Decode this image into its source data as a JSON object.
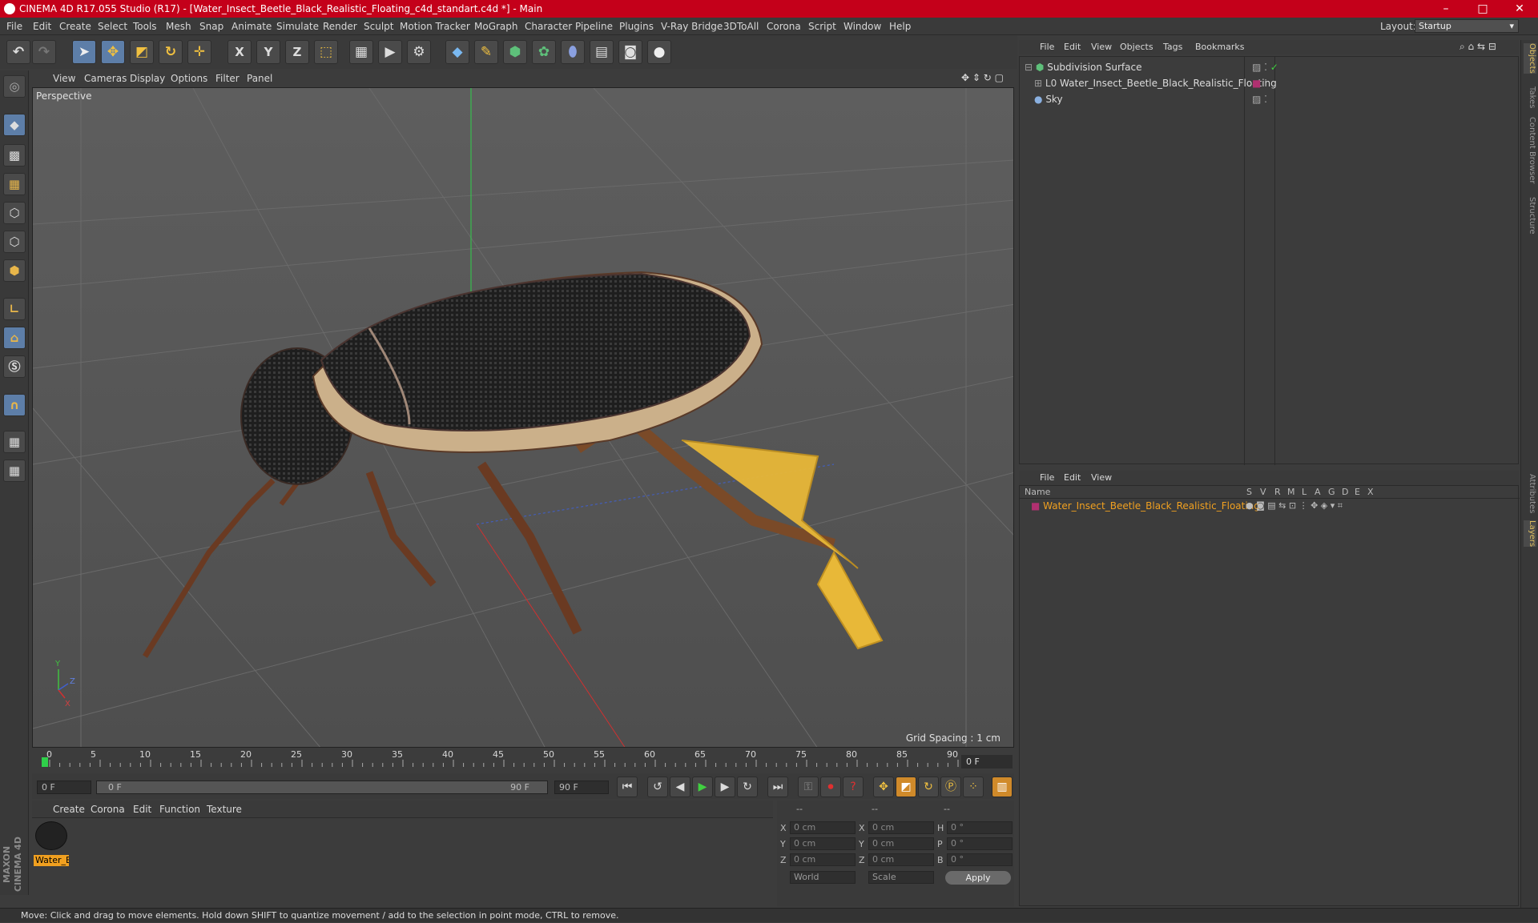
{
  "window": {
    "title": "CINEMA 4D R17.055 Studio (R17) - [Water_Insect_Beetle_Black_Realistic_Floating_c4d_standart.c4d *] - Main",
    "controls": [
      "–",
      "□",
      "✕"
    ]
  },
  "menu": [
    "File",
    "Edit",
    "Create",
    "Select",
    "Tools",
    "Mesh",
    "Snap",
    "Animate",
    "Simulate",
    "Render",
    "Sculpt",
    "Motion Tracker",
    "MoGraph",
    "Character",
    "Pipeline",
    "Plugins",
    "V-Ray Bridge",
    "3DToAll",
    "Corona",
    "Script",
    "Window",
    "Help"
  ],
  "layout": {
    "label": "Layout:",
    "value": "Startup"
  },
  "toolbar_xyz": [
    "X",
    "Y",
    "Z"
  ],
  "viewport": {
    "menu": [
      "View",
      "Cameras",
      "Display",
      "Options",
      "Filter",
      "Panel"
    ],
    "label": "Perspective",
    "grid_spacing": "Grid Spacing : 1 cm",
    "axis_labels": [
      "Y",
      "Z",
      "X"
    ]
  },
  "timeline": {
    "ticks": [
      "0",
      "5",
      "10",
      "15",
      "20",
      "25",
      "30",
      "35",
      "40",
      "45",
      "50",
      "55",
      "60",
      "65",
      "70",
      "75",
      "80",
      "85",
      "90"
    ],
    "current_frame": "0 F",
    "start_field": "0 F",
    "range_start": "0 F",
    "range_end": "90 F",
    "end_field": "90 F"
  },
  "material_manager": {
    "menu": [
      "Create",
      "Corona",
      "Edit",
      "Function",
      "Texture"
    ],
    "materials": [
      {
        "label": "Water_E"
      }
    ]
  },
  "coordinates": {
    "headers": [
      "--",
      "--",
      "--"
    ],
    "rows": [
      {
        "a": "X",
        "av": "0 cm",
        "b": "X",
        "bv": "0 cm",
        "c": "H",
        "cv": "0 °"
      },
      {
        "a": "Y",
        "av": "0 cm",
        "b": "Y",
        "bv": "0 cm",
        "c": "P",
        "cv": "0 °"
      },
      {
        "a": "Z",
        "av": "0 cm",
        "b": "Z",
        "bv": "0 cm",
        "c": "B",
        "cv": "0 °"
      }
    ],
    "mode1": "World",
    "mode2": "Scale",
    "apply": "Apply"
  },
  "object_manager": {
    "menu": [
      "File",
      "Edit",
      "View",
      "Objects",
      "Tags",
      "Bookmarks"
    ],
    "objects": [
      {
        "name": "Subdivision Surface"
      },
      {
        "name": "Water_Insect_Beetle_Black_Realistic_Floating"
      },
      {
        "name": "Sky"
      }
    ]
  },
  "layer_manager": {
    "menu": [
      "File",
      "Edit",
      "View"
    ],
    "columns": [
      "Name",
      "S",
      "V",
      "R",
      "M",
      "L",
      "A",
      "G",
      "D",
      "E",
      "X"
    ],
    "layers": [
      {
        "name": "Water_Insect_Beetle_Black_Realistic_Floating",
        "color": "#b03070"
      }
    ]
  },
  "right_tabs": [
    "Objects",
    "Takes",
    "Content Browser",
    "Structure",
    "Attributes",
    "Layers"
  ],
  "brand": "MAXON CINEMA 4D",
  "status": "Move: Click and drag to move elements. Hold down SHIFT to quantize movement / add to the selection in point mode, CTRL to remove."
}
